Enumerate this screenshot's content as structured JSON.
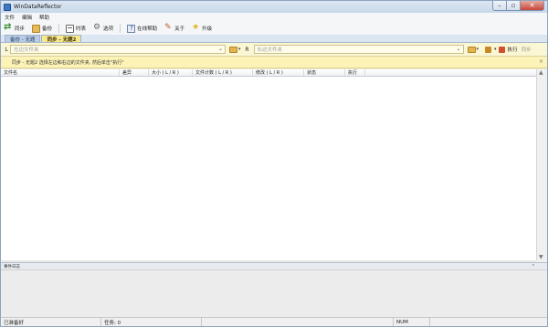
{
  "window": {
    "title": "WinDataReflector"
  },
  "menu": [
    "文件",
    "编辑",
    "帮助"
  ],
  "toolbar": {
    "sync": "同步",
    "backup": "备份",
    "timer": "时表",
    "options": "选项",
    "online_help": "在线帮助",
    "about": "关于",
    "upgrade": "升级"
  },
  "tabs": [
    {
      "label": "备份 - 无题"
    },
    {
      "label": "同步 - 无题2"
    }
  ],
  "folder_bar": {
    "left_label": "L",
    "left_placeholder": "左边文件夹",
    "right_label": "R",
    "right_placeholder": "右边文件夹",
    "execute": "执行",
    "sync": "同步"
  },
  "info_message": "同步 - 无题2  选择左边和右边的文件夹, 然后单击\"执行\"",
  "columns": [
    "文件名",
    "差异",
    "大小 ( L / R )",
    "文件计数 ( L / R )",
    "修改 ( L / R )",
    "状态",
    "执行"
  ],
  "log": {
    "title": "事件日志"
  },
  "statusbar": {
    "ready": "已准备好",
    "tasks": "任务: 0",
    "num": "NUM"
  }
}
